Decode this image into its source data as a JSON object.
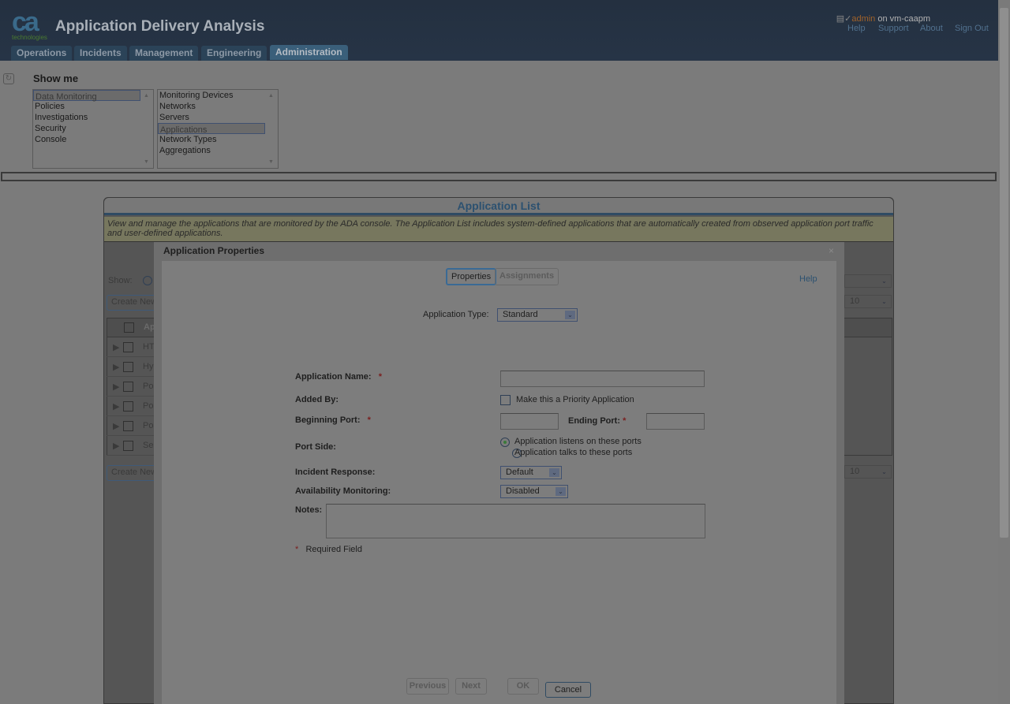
{
  "header": {
    "logo_text": "ca",
    "logo_sub": "technologies",
    "title": "Application Delivery Analysis",
    "user": "admin",
    "user_suffix": "on vm-caapm",
    "links": [
      "Help",
      "Support",
      "About",
      "Sign Out"
    ],
    "tabs": [
      "Operations",
      "Incidents",
      "Management",
      "Engineering",
      "Administration"
    ],
    "active_tab": "Administration"
  },
  "showme": {
    "label": "Show me",
    "list1": [
      "Data Monitoring",
      "Policies",
      "Investigations",
      "Security",
      "Console"
    ],
    "list1_selected": "Data Monitoring",
    "list2": [
      "Monitoring Devices",
      "Networks",
      "Servers",
      "Applications",
      "Network Types",
      "Aggregations"
    ],
    "list2_selected": "Applications"
  },
  "panel": {
    "title": "Application List",
    "description": "View and manage the applications that are monitored by the ADA console. The Application List includes system-defined applications that are automatically created from observed application port traffic and user-defined applications.",
    "show_label": "Show:",
    "create_label": "Create New",
    "header_col": "Ap",
    "rows": [
      "HT",
      "Hy",
      "Po",
      "Po",
      "Po",
      "Se"
    ],
    "page_size": "10"
  },
  "dialog": {
    "title": "Application Properties",
    "close": "×",
    "tabs": [
      "Properties",
      "Assignments"
    ],
    "help": "Help",
    "app_type_label": "Application Type:",
    "app_type_value": "Standard",
    "name_label": "Application Name:",
    "name_value": "",
    "added_by_label": "Added By:",
    "priority_label": "Make this a Priority Application",
    "begin_port_label": "Beginning Port:",
    "end_port_label": "Ending Port:",
    "port_side_label": "Port Side:",
    "port_side_options": [
      "Application listens on these ports",
      "Application talks to these ports"
    ],
    "incident_label": "Incident Response:",
    "incident_value": "Default",
    "avail_label": "Availability Monitoring:",
    "avail_value": "Disabled",
    "notes_label": "Notes:",
    "required_star": "*",
    "required_note": "Required Field",
    "buttons": {
      "previous": "Previous",
      "next": "Next",
      "ok": "OK",
      "cancel": "Cancel"
    }
  }
}
